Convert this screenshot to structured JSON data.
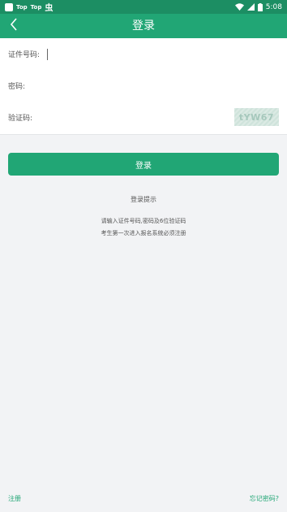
{
  "status_bar": {
    "app_labels": [
      "Top",
      "Top"
    ],
    "glyph": "虫",
    "battery": "▮",
    "time": "5:08"
  },
  "header": {
    "title": "登录",
    "back_icon": "chevron-left-icon"
  },
  "form": {
    "id_label": "证件号码:",
    "id_value": "",
    "password_label": "密码:",
    "password_value": "",
    "captcha_label": "验证码:",
    "captcha_value": "",
    "captcha_image_text": "tYW67"
  },
  "login_button": "登录",
  "tips": {
    "title": "登录提示",
    "lines": [
      "请输入证件号码,密码及6位验证码",
      "考生第一次进入报名系统必须注册"
    ]
  },
  "footer": {
    "register": "注册",
    "forgot_password": "忘记密码?"
  },
  "colors": {
    "accent": "#21A675",
    "status_bar": "#1C8E63",
    "background": "#F2F3F5"
  }
}
